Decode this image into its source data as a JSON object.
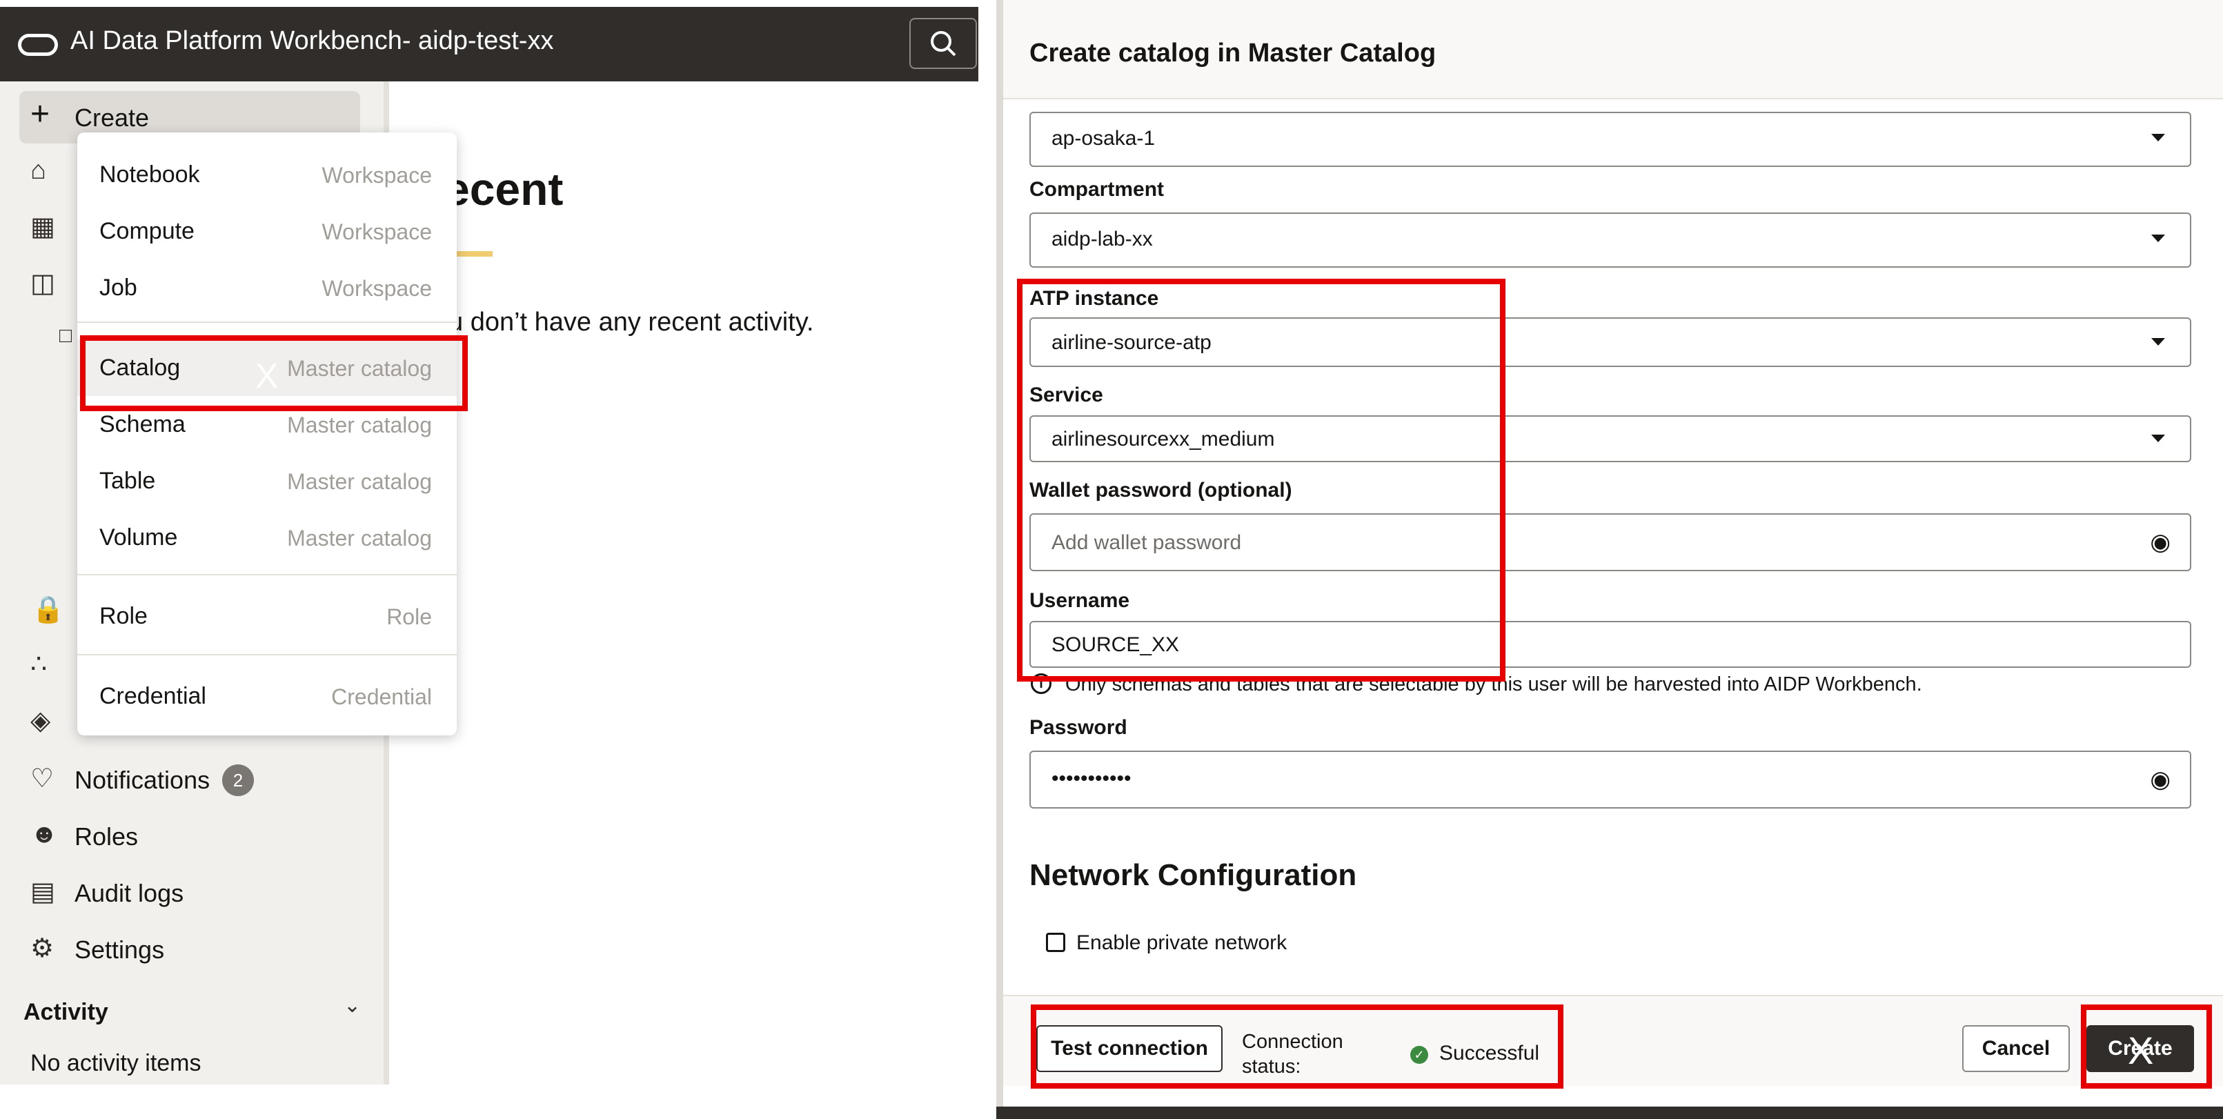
{
  "left": {
    "app_title": "AI Data Platform Workbench- aidp-test-xx",
    "create_label": "Create",
    "recent_heading": "ecent",
    "recent_message": "u don’t have any recent activity.",
    "create_menu": {
      "items": [
        {
          "label": "Notebook",
          "hint": "Workspace"
        },
        {
          "label": "Compute",
          "hint": "Workspace"
        },
        {
          "label": "Job",
          "hint": "Workspace"
        },
        {
          "label": "Catalog",
          "hint": "Master catalog"
        },
        {
          "label": "Schema",
          "hint": "Master catalog"
        },
        {
          "label": "Table",
          "hint": "Master catalog"
        },
        {
          "label": "Volume",
          "hint": "Master catalog"
        },
        {
          "label": "Role",
          "hint": "Role"
        },
        {
          "label": "Credential",
          "hint": "Credential"
        }
      ],
      "click_marker": "X"
    },
    "sidebar": {
      "items": [
        {
          "label": "Notifications",
          "icon": "bell-icon",
          "badge": "2"
        },
        {
          "label": "Roles",
          "icon": "roles-icon"
        },
        {
          "label": "Audit logs",
          "icon": "audit-logs-icon"
        },
        {
          "label": "Settings",
          "icon": "gear-icon"
        }
      ],
      "activity_title": "Activity",
      "no_activity": "No activity items"
    }
  },
  "dialog": {
    "title": "Create catalog in Master Catalog",
    "region": {
      "value": "ap-osaka-1"
    },
    "compartment": {
      "label": "Compartment",
      "value": "aidp-lab-xx"
    },
    "atp_instance": {
      "label": "ATP instance",
      "value": "airline-source-atp"
    },
    "service": {
      "label": "Service",
      "value": "airlinesourcexx_medium"
    },
    "wallet_password": {
      "label": "Wallet password (optional)",
      "placeholder": "Add wallet password"
    },
    "username": {
      "label": "Username",
      "value": "SOURCE_XX",
      "hint": "Only schemas and tables that are selectable by this user will be harvested into AIDP Workbench."
    },
    "password": {
      "label": "Password",
      "value": "•••••••••••"
    },
    "network_title": "Network Configuration",
    "private_network_label": "Enable private network",
    "test_connection": "Test connection",
    "connection_status_label": "Connection status:",
    "connection_status_value": "Successful",
    "cancel": "Cancel",
    "create": "Create",
    "click_marker": "X"
  },
  "colors": {
    "highlight_box": "#e60000",
    "topbar": "#312d2a",
    "accent_underline": "#f0cc71",
    "success": "#3a8a40"
  }
}
